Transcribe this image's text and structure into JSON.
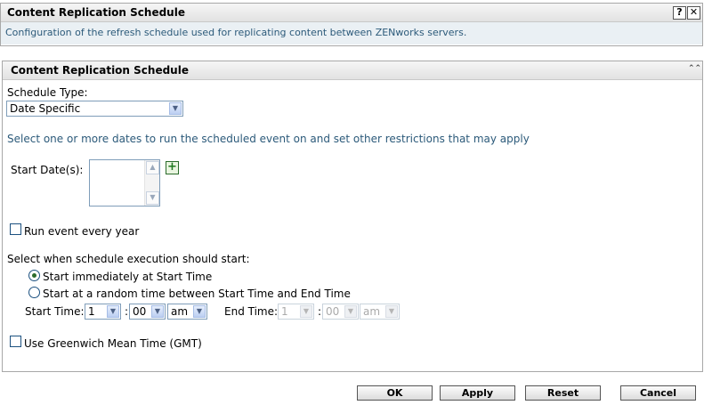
{
  "top_panel": {
    "title": "Content Replication Schedule",
    "description": "Configuration of the refresh schedule used for replicating content between ZENworks servers.",
    "help_label": "?",
    "close_label": "✕"
  },
  "main_panel": {
    "title": "Content Replication Schedule",
    "schedule_type_label": "Schedule Type:",
    "schedule_type_value": "Date Specific",
    "instructions": "Select one or more dates to run the scheduled event on and set other restrictions that may apply",
    "start_dates_label": "Start Date(s):",
    "run_every_year_label": "Run event every year",
    "execution_label": "Select when schedule execution should start:",
    "radio_immediate_label": "Start immediately at Start Time",
    "radio_random_label": "Start at a random time between Start Time and End Time",
    "start_time_label": "Start Time:",
    "start_hour": "1",
    "start_minute": "00",
    "start_ampm": "am",
    "end_time_label": "End Time:",
    "end_hour": "1",
    "end_minute": "00",
    "end_ampm": "am",
    "colon": ":",
    "gmt_label": "Use Greenwich Mean Time (GMT)"
  },
  "buttons": {
    "ok": "OK",
    "apply": "Apply",
    "reset": "Reset",
    "cancel": "Cancel"
  }
}
